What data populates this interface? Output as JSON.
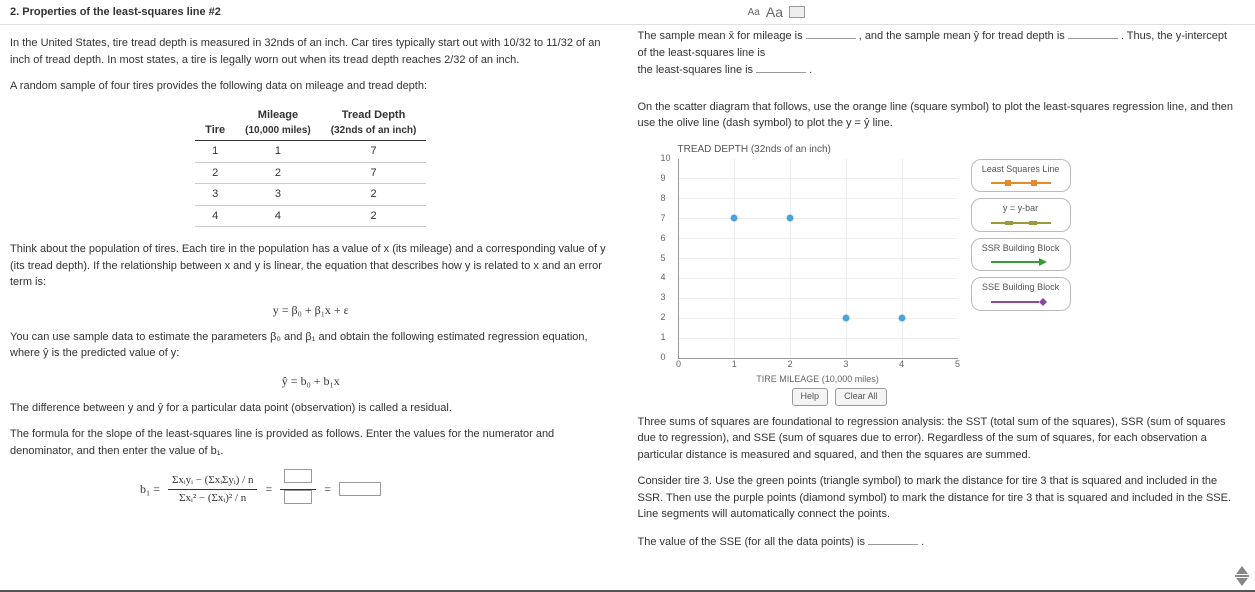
{
  "topbar": {
    "title": "2.  Properties of the least-squares line #2",
    "aa_small": "Aa",
    "aa_large": "Aa"
  },
  "left": {
    "p1": "In the United States, tire tread depth is measured in 32nds of an inch. Car tires typically start out with 10/32 to 11/32 of an inch of tread depth. In most states, a tire is legally worn out when its tread depth reaches 2/32 of an inch.",
    "p2": "A random sample of four tires provides the following data on mileage and tread depth:",
    "table": {
      "h_tire": "Tire",
      "h_mileage": "Mileage",
      "h_mileage_sub": "(10,000 miles)",
      "h_depth": "Tread Depth",
      "h_depth_sub": "(32nds of an inch)",
      "rows": [
        {
          "tire": "1",
          "mileage": "1",
          "depth": "7"
        },
        {
          "tire": "2",
          "mileage": "2",
          "depth": "7"
        },
        {
          "tire": "3",
          "mileage": "3",
          "depth": "2"
        },
        {
          "tire": "4",
          "mileage": "4",
          "depth": "2"
        }
      ]
    },
    "p3": "Think about the population of tires. Each tire in the population has a value of x (its mileage) and a corresponding value of y (its tread depth). If the relationship between x and y is linear, the equation that describes how y is related to x and an error term is:",
    "eq1": "y   =   β₀ + β₁x + ε",
    "p4": "You can use sample data to estimate the parameters β₀ and β₁ and obtain the following estimated regression equation, where ŷ is the predicted value of y:",
    "eq2": "ŷ   =   b₀ + b₁x",
    "p5": "The difference between y and ŷ for a particular data point (observation) is called a residual.",
    "p6": "The formula for the slope of the least-squares line is provided as follows. Enter the values for the numerator and denominator, and then enter the value of b₁.",
    "formula": {
      "b1_label": "b₁   =",
      "num": "Σxᵢyᵢ − (ΣxᵢΣyᵢ) / n",
      "den": "Σxᵢ² − (Σxᵢ)² / n",
      "eq": "="
    }
  },
  "right": {
    "p1a": "The sample mean x̄ for mileage is ",
    "p1b": " , and the sample mean ŷ for tread depth is ",
    "p1c": " . Thus, the y-intercept of the least-squares line is ",
    "p1d": " .",
    "p2": "On the scatter diagram that follows, use the orange line (square symbol) to plot the least-squares regression line, and then use the olive line (dash symbol) to plot the y = ŷ line.",
    "chart": {
      "ytitle": "TREAD DEPTH (32nds of an inch)",
      "xlabel": "TIRE MILEAGE (10,000 miles)",
      "yticks": [
        "0",
        "1",
        "2",
        "3",
        "4",
        "5",
        "6",
        "7",
        "8",
        "9",
        "10"
      ],
      "xticks": [
        "0",
        "1",
        "2",
        "3",
        "4",
        "5"
      ],
      "legend": {
        "l1": "Least Squares Line",
        "l2": "y = y-bar",
        "l3": "SSR Building Block",
        "l4": "SSE Building Block"
      },
      "buttons": {
        "help": "Help",
        "clear": "Clear All"
      }
    },
    "p3": "Three sums of squares are foundational to regression analysis: the SST (total sum of the squares), SSR (sum of squares due to regression), and SSE (sum of squares due to error). Regardless of the sum of squares, for each observation a particular distance is measured and squared, and then the squares are summed.",
    "p4": "Consider tire 3. Use the green points (triangle symbol) to mark the distance for tire 3 that is squared and included in the SSR. Then use the purple points (diamond symbol) to mark the distance for tire 3 that is squared and included in the SSE. Line segments will automatically connect the points.",
    "p5a": "The value of the SSE (for all the data points) is ",
    "p5b": " ."
  },
  "chart_data": {
    "type": "scatter",
    "title": "TREAD DEPTH (32nds of an inch)",
    "xlabel": "TIRE MILEAGE (10,000 miles)",
    "ylabel": "TREAD DEPTH (32nds of an inch)",
    "xlim": [
      0,
      5
    ],
    "ylim": [
      0,
      10
    ],
    "series": [
      {
        "name": "data",
        "x": [
          1,
          2,
          3,
          4
        ],
        "y": [
          7,
          7,
          2,
          2
        ]
      }
    ]
  }
}
